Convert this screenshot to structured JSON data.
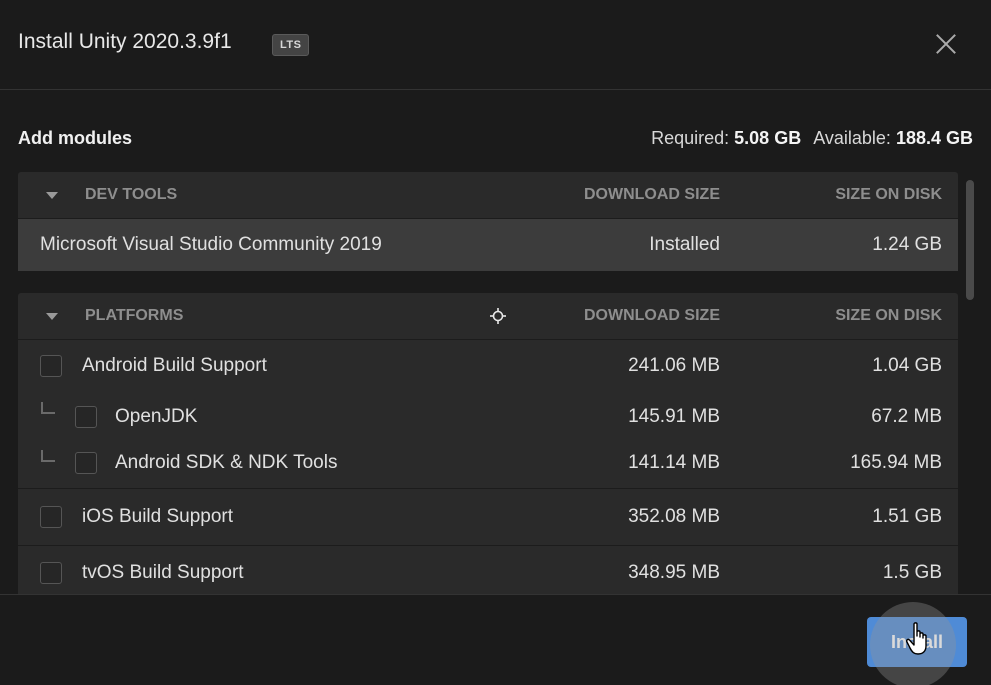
{
  "header": {
    "title": "Install Unity 2020.3.9f1",
    "badge": "LTS"
  },
  "modules": {
    "heading": "Add modules",
    "required_label": "Required:",
    "required_value": "5.08 GB",
    "available_label": "Available:",
    "available_value": "188.4 GB"
  },
  "groups": [
    {
      "name": "DEV TOOLS",
      "col_download": "DOWNLOAD SIZE",
      "col_disk": "SIZE ON DISK",
      "rows": [
        {
          "name": "Microsoft Visual Studio Community 2019",
          "download": "Installed",
          "disk": "1.24 GB"
        }
      ]
    },
    {
      "name": "PLATFORMS",
      "col_download": "DOWNLOAD SIZE",
      "col_disk": "SIZE ON DISK",
      "rows": [
        {
          "name": "Android Build Support",
          "download": "241.06 MB",
          "disk": "1.04 GB"
        },
        {
          "name": "OpenJDK",
          "download": "145.91 MB",
          "disk": "67.2 MB"
        },
        {
          "name": "Android SDK & NDK Tools",
          "download": "141.14 MB",
          "disk": "165.94 MB"
        },
        {
          "name": "iOS Build Support",
          "download": "352.08 MB",
          "disk": "1.51 GB"
        },
        {
          "name": "tvOS Build Support",
          "download": "348.95 MB",
          "disk": "1.5 GB"
        }
      ]
    }
  ],
  "footer": {
    "install_label": "Install"
  },
  "icons": {
    "close": "close-icon",
    "collapse": "chevron-down-icon",
    "cursor": "hand-pointer-icon",
    "crosshair": "crosshair-icon"
  },
  "colors": {
    "accent": "#4f8bd6",
    "background": "#1b1b1b",
    "panel": "#2a2a2a",
    "installed_row": "#3c3c3c"
  }
}
